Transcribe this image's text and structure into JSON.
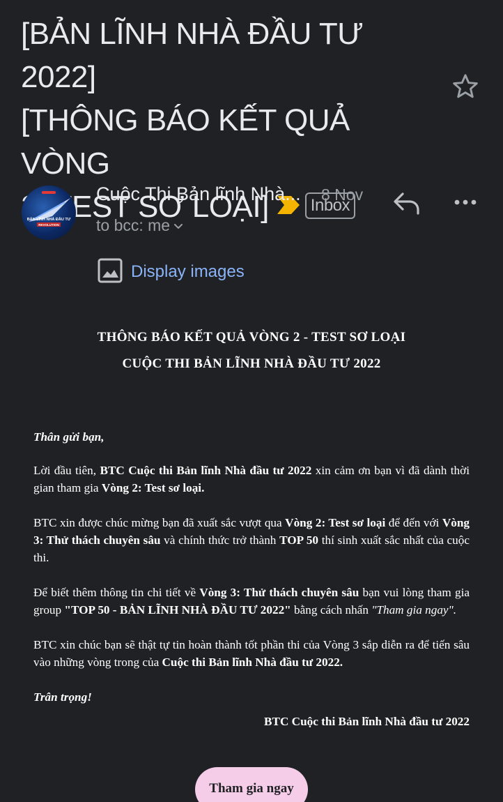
{
  "subject": {
    "line1": "[BẢN LĨNH NHÀ ĐẦU TƯ 2022]",
    "line2": "[THÔNG BÁO KẾT QUẢ VÒNG",
    "line3": "2: TEST SƠ LOẠI]",
    "label_chip": "Inbox",
    "importance_icon": "importance-marker-icon",
    "importance_color": "#f4b400"
  },
  "message_header": {
    "sender": "Cuộc Thi Bản lĩnh Nhà...",
    "date": "8 Nov",
    "recipients": "to bcc: me",
    "avatar_text": "BẢN LĨNH NHÀ ĐẦU TƯ",
    "avatar_subtext": "REVOLUTION"
  },
  "display_images": {
    "label": "Display images",
    "icon": "image-icon"
  },
  "body": {
    "heading1": "THÔNG BÁO KẾT QUẢ VÒNG 2 - TEST SƠ LOẠI",
    "heading2": "CUỘC THI BẢN LĨNH NHÀ ĐẦU TƯ 2022",
    "greeting": "Thân gửi bạn,",
    "p1": {
      "a": "Lời đầu tiên, ",
      "b": "BTC Cuộc thi Bản lĩnh Nhà đầu tư 2022",
      "c": " xin cảm ơn bạn vì đã dành thời gian tham gia ",
      "d": "Vòng 2: Test sơ loại."
    },
    "p2": {
      "a": "BTC xin được chúc mừng bạn đã xuất sắc vượt qua ",
      "b": "Vòng 2: Test sơ loại",
      "c": " để đến với ",
      "d": "Vòng 3: Thử thách chuyên sâu",
      "e": " và chính thức trở thành ",
      "f": "TOP 50",
      "g": " thí sinh xuất sắc nhất của cuộc thi."
    },
    "p3": {
      "a": "Để biết thêm thông tin chi tiết về ",
      "b": "Vòng 3: Thử thách chuyên sâu",
      "c": " bạn vui lòng tham gia group ",
      "d": "\"TOP 50 - BẢN LĨNH NHÀ ĐẦU TƯ 2022\"",
      "e": "  bằng cách nhấn ",
      "f": "\"Tham gia ngay\"."
    },
    "p4": {
      "a": "BTC xin chúc bạn sẽ thật tự tin hoàn thành tốt phần thi của Vòng 3 sắp diễn ra để tiến sâu vào những vòng trong của ",
      "b": "Cuộc thi Bản lĩnh Nhà đầu tư 2022."
    },
    "closing": "Trân trọng!",
    "signature": "BTC Cuộc thi Bản lĩnh Nhà đầu tư 2022"
  },
  "cta": {
    "label": "Tham gia ngay",
    "color": "#f6cde8"
  }
}
